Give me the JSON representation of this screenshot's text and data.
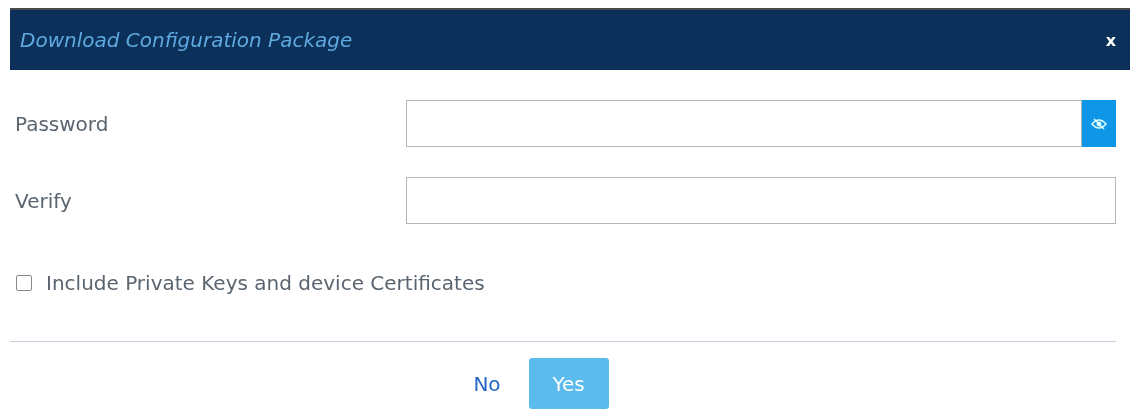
{
  "dialog": {
    "title": "Download Configuration Package",
    "close": "x"
  },
  "fields": [
    {
      "label": "Password",
      "reveal_button": true
    },
    {
      "label": "Verify",
      "reveal_button": false
    }
  ],
  "checkbox": {
    "label": "Include Private Keys and device Certificates",
    "checked": false
  },
  "buttons": [
    {
      "label": "No",
      "kind": "link"
    },
    {
      "label": "Yes",
      "kind": "primary"
    }
  ]
}
